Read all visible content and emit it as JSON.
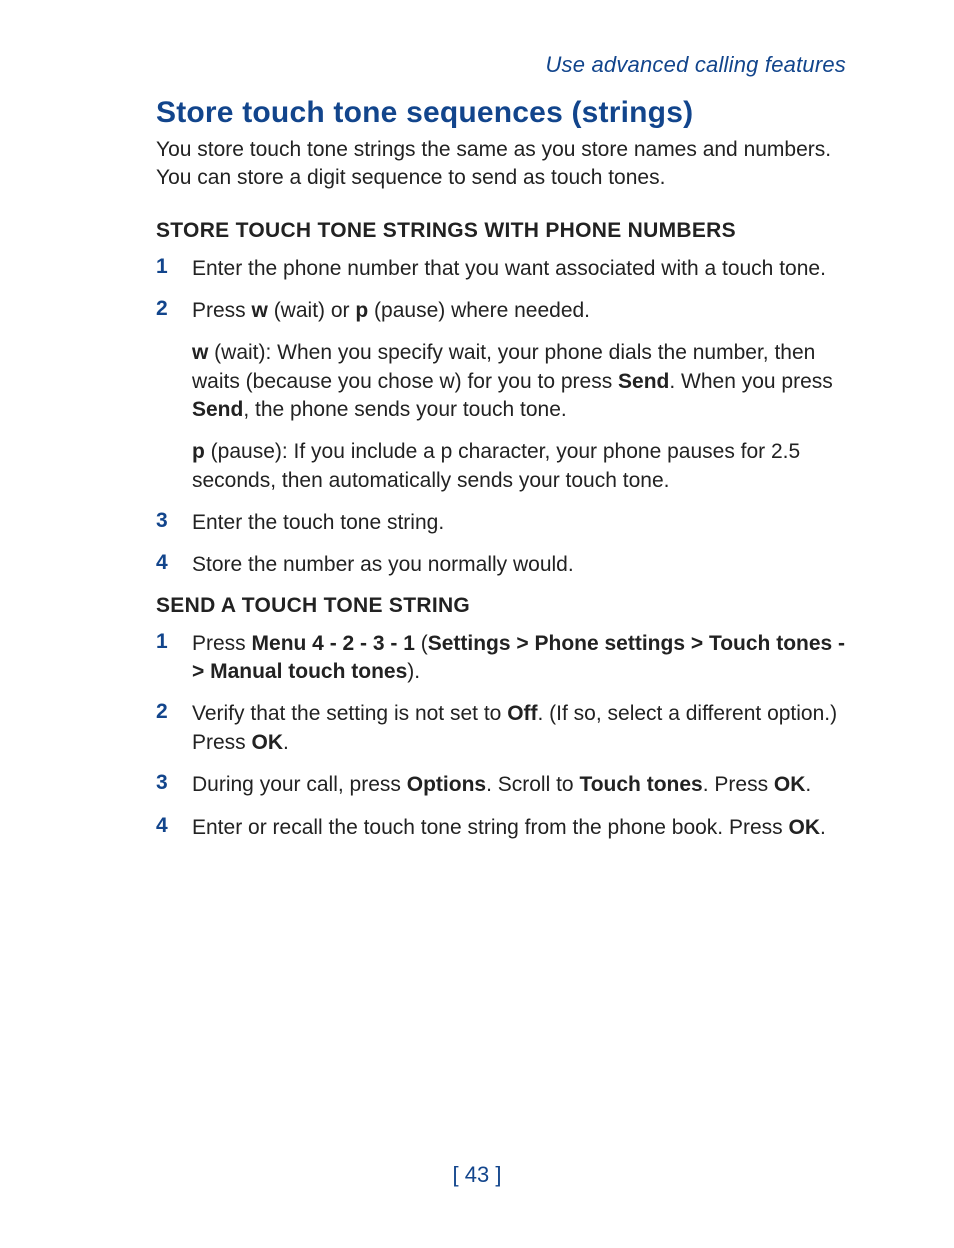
{
  "runningHead": "Use advanced calling features",
  "title": "Store touch tone sequences (strings)",
  "intro": "You store touch tone strings the same as you store names and numbers. You can store a digit sequence to send as touch tones.",
  "sectionA": {
    "heading": "STORE TOUCH TONE STRINGS WITH PHONE NUMBERS",
    "steps": {
      "n1": "1",
      "s1": "Enter the phone number that you want associated with a touch tone.",
      "n2": "2",
      "s2_a": "Press ",
      "s2_w": "w",
      "s2_b": " (wait) or ",
      "s2_p": "p",
      "s2_c": " (pause) where needed.",
      "s2_wpara_a": "w",
      "s2_wpara_b": " (wait): When you specify wait, your phone dials the number, then waits (because you chose w) for you to press ",
      "s2_wpara_send1": "Send",
      "s2_wpara_c": ". When you press ",
      "s2_wpara_send2": "Send",
      "s2_wpara_d": ", the phone sends your touch tone.",
      "s2_ppara_a": "p",
      "s2_ppara_b": " (pause): If you include a p character, your phone pauses for 2.5 seconds, then automatically sends your touch tone.",
      "n3": "3",
      "s3": "Enter the touch tone string.",
      "n4": "4",
      "s4": "Store the number as you normally would."
    }
  },
  "sectionB": {
    "heading": "SEND A TOUCH TONE STRING",
    "steps": {
      "n1": "1",
      "s1_a": "Press ",
      "s1_menu": "Menu 4 - 2 - 3 - 1",
      "s1_b": " (",
      "s1_path": "Settings > Phone settings > Touch tones -> Manual touch tones",
      "s1_c": ").",
      "n2": "2",
      "s2_a": "Verify that the setting is not set to ",
      "s2_off": "Off",
      "s2_b": ". (If so, select a different option.) Press ",
      "s2_ok": "OK",
      "s2_c": ".",
      "n3": "3",
      "s3_a": "During your call, press ",
      "s3_options": "Options",
      "s3_b": ". Scroll to ",
      "s3_tt": "Touch tones",
      "s3_c": ". Press ",
      "s3_ok": "OK",
      "s3_d": ".",
      "n4": "4",
      "s4_a": "Enter or recall the touch tone string from the phone book. Press ",
      "s4_ok": "OK",
      "s4_b": "."
    }
  },
  "pageNumber": "[ 43 ]"
}
